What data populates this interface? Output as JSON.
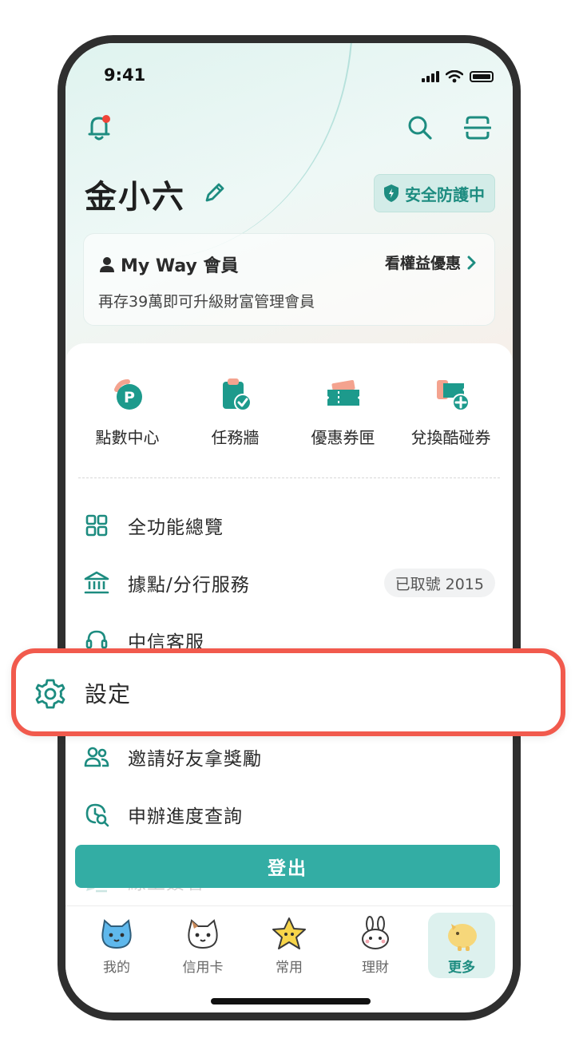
{
  "status_bar": {
    "time": "9:41"
  },
  "header": {
    "user_name": "金小六",
    "security_badge": "安全防護中"
  },
  "member_card": {
    "title": "My Way 會員",
    "benefit_link": "看權益優惠",
    "subtitle": "再存39萬即可升級財富管理會員"
  },
  "quick_actions": [
    {
      "label": "點數中心",
      "icon": "points-icon"
    },
    {
      "label": "任務牆",
      "icon": "task-clipboard-icon"
    },
    {
      "label": "優惠券匣",
      "icon": "coupon-icon"
    },
    {
      "label": "兌換酷碰券",
      "icon": "exchange-coupon-icon"
    }
  ],
  "menu": {
    "all_functions": "全功能總覽",
    "branch_service": "據點/分行服務",
    "branch_badge": "已取號 2015",
    "customer_service": "中信客服",
    "settings": "設定",
    "invite_friends": "邀請好友拿獎勵",
    "application_progress": "申辦進度查詢",
    "online_signing": "線上簽署"
  },
  "logout_label": "登出",
  "tabbar": [
    {
      "label": "我的",
      "icon": "blue-cat-icon",
      "active": false
    },
    {
      "label": "信用卡",
      "icon": "white-cat-icon",
      "active": false
    },
    {
      "label": "常用",
      "icon": "star-icon",
      "active": false
    },
    {
      "label": "理財",
      "icon": "bunny-icon",
      "active": false
    },
    {
      "label": "更多",
      "icon": "piggy-icon",
      "active": true
    }
  ],
  "colors": {
    "accent": "#33ada4",
    "accent_dark": "#1d8c80",
    "highlight": "#f15a4d",
    "notification_dot": "#f04438"
  }
}
